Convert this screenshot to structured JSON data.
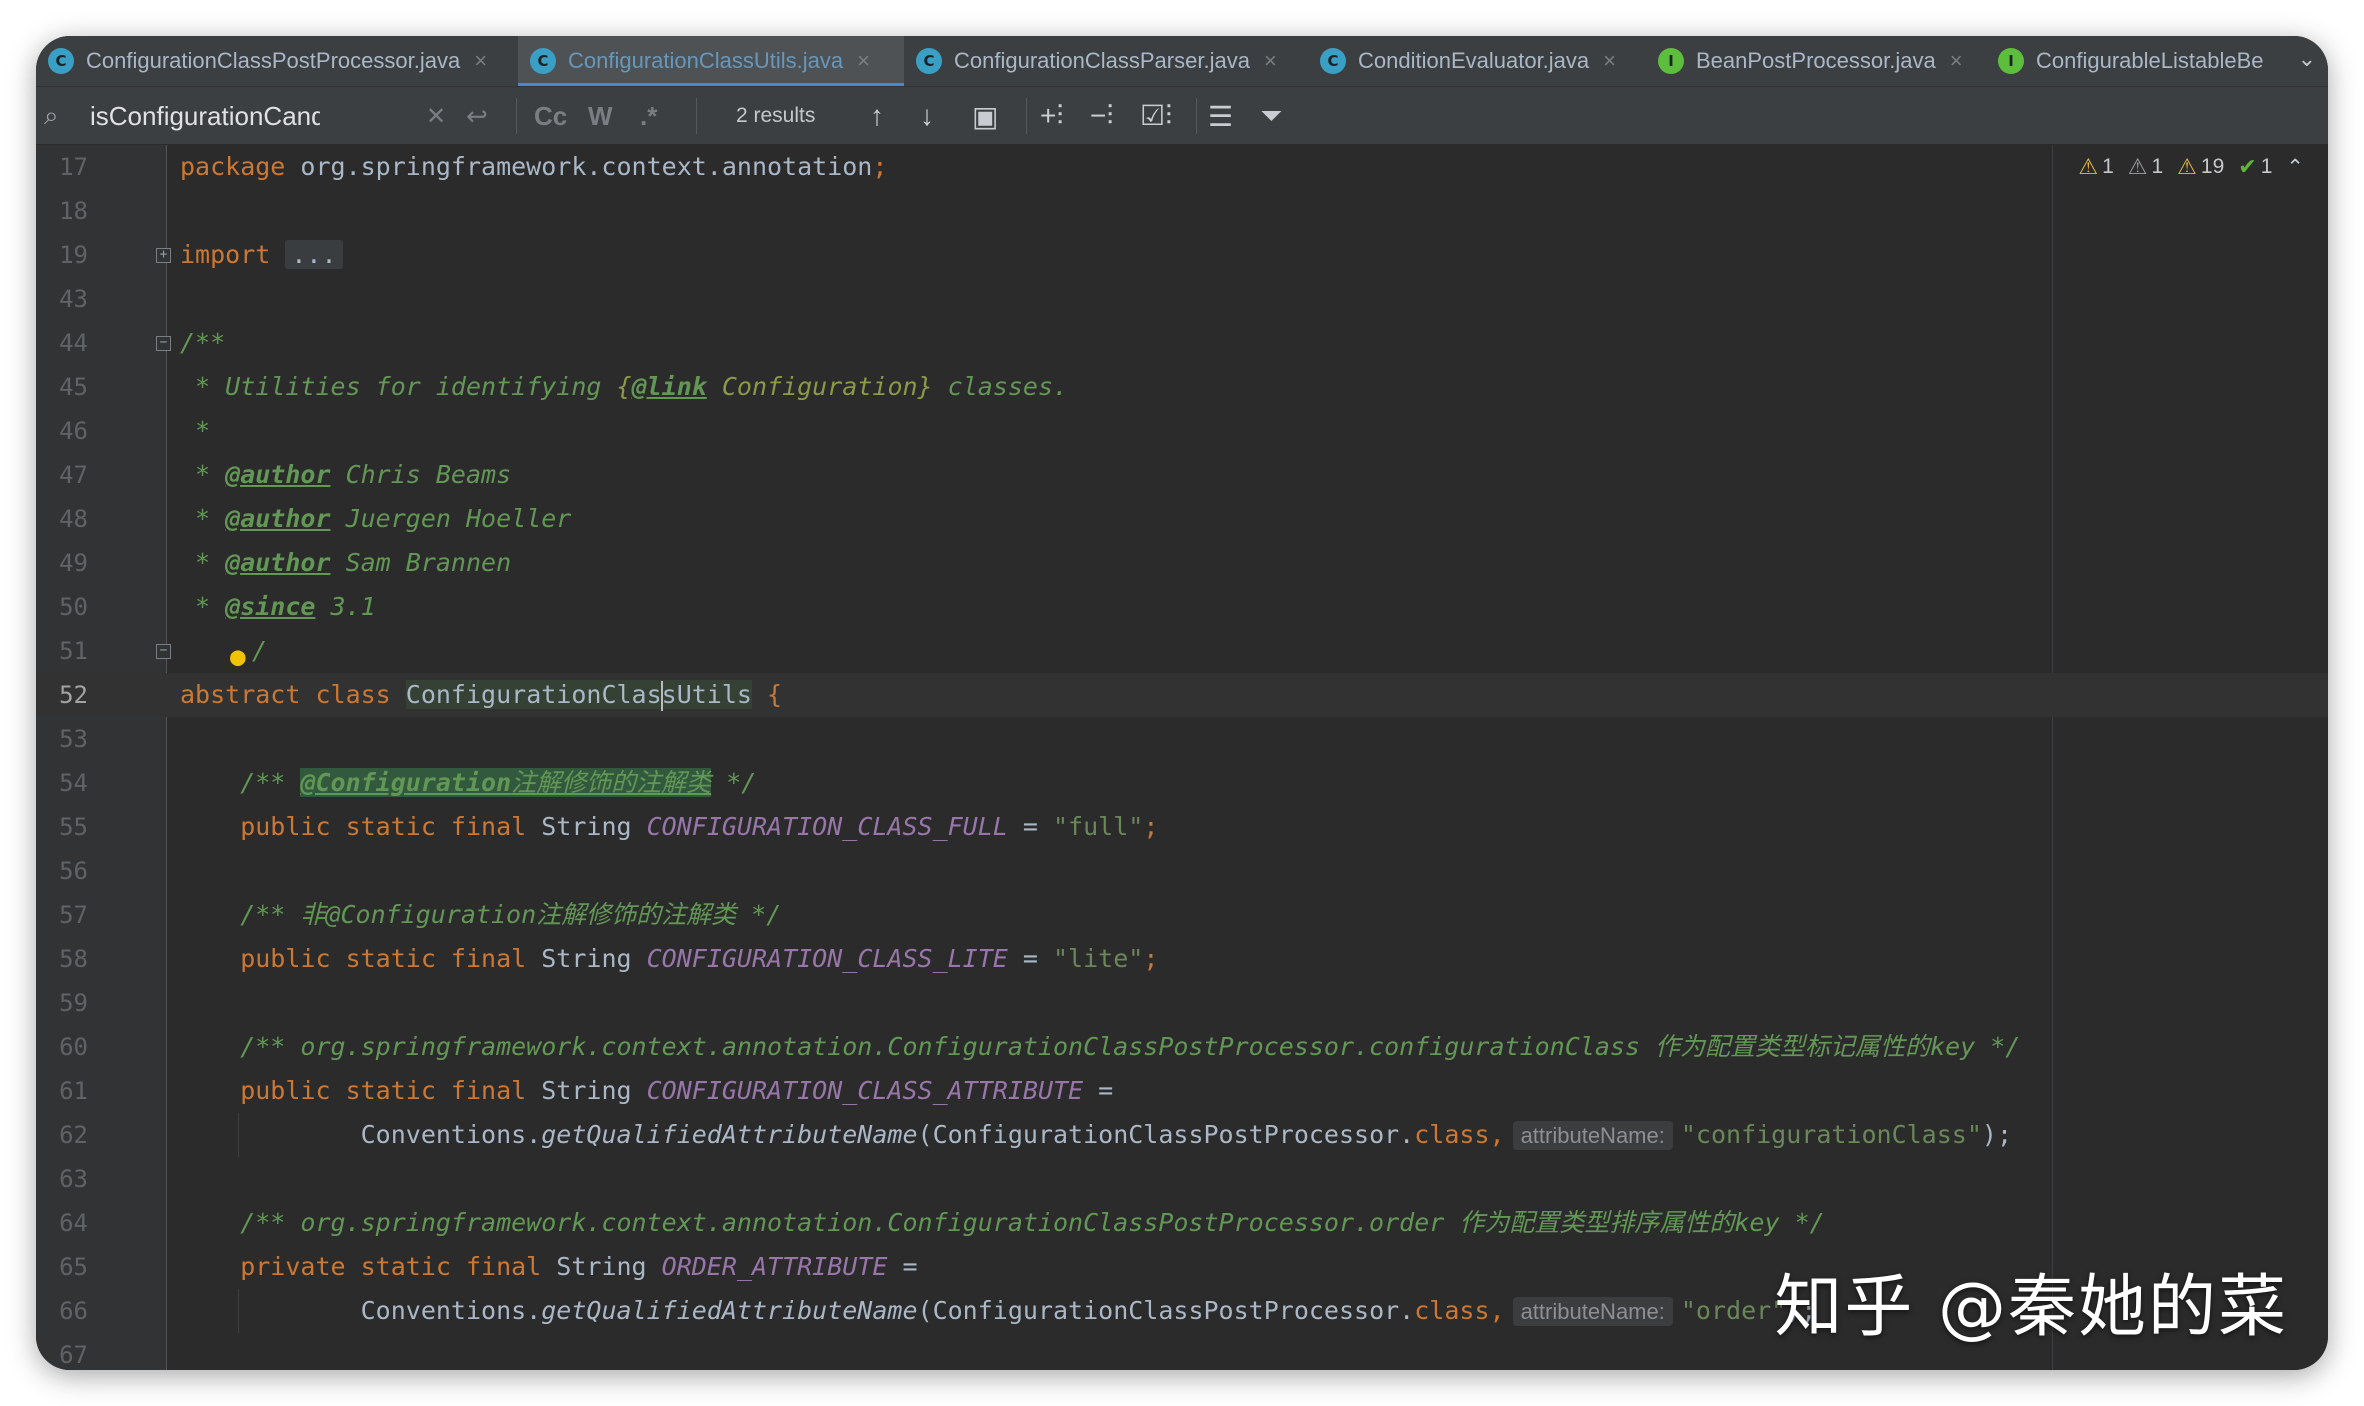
{
  "tabs": [
    {
      "label": "ConfigurationClassPostProcessor.java",
      "icon": "class-icon",
      "icon_letter": "C",
      "active": false
    },
    {
      "label": "ConfigurationClassUtils.java",
      "icon": "class-icon",
      "icon_letter": "C",
      "active": true
    },
    {
      "label": "ConfigurationClassParser.java",
      "icon": "class-icon",
      "icon_letter": "C",
      "active": false
    },
    {
      "label": "ConditionEvaluator.java",
      "icon": "class-icon",
      "icon_letter": "C",
      "active": false
    },
    {
      "label": "BeanPostProcessor.java",
      "icon": "interface-icon",
      "icon_letter": "I",
      "active": false
    },
    {
      "label": "ConfigurableListableBe",
      "icon": "interface-icon",
      "icon_letter": "I",
      "active": false
    }
  ],
  "tab_close_glyph": "×",
  "tab_more_glyph": "⌄",
  "find": {
    "query": "isConfigurationCandidate",
    "results": "2 results",
    "match_case_label": "Cc",
    "words_label": "W",
    "regex_label": ".*"
  },
  "inspections": {
    "warnings_yellow": "1",
    "warnings_gray": "1",
    "weak_warnings": "19",
    "typos": "1"
  },
  "lines": [
    {
      "n": "17"
    },
    {
      "n": "18"
    },
    {
      "n": "19"
    },
    {
      "n": "43"
    },
    {
      "n": "44"
    },
    {
      "n": "45"
    },
    {
      "n": "46"
    },
    {
      "n": "47"
    },
    {
      "n": "48"
    },
    {
      "n": "49"
    },
    {
      "n": "50"
    },
    {
      "n": "51"
    },
    {
      "n": "52"
    },
    {
      "n": "53"
    },
    {
      "n": "54"
    },
    {
      "n": "55"
    },
    {
      "n": "56"
    },
    {
      "n": "57"
    },
    {
      "n": "58"
    },
    {
      "n": "59"
    },
    {
      "n": "60"
    },
    {
      "n": "61"
    },
    {
      "n": "62"
    },
    {
      "n": "63"
    },
    {
      "n": "64"
    },
    {
      "n": "65"
    },
    {
      "n": "66"
    },
    {
      "n": "67"
    }
  ],
  "code": {
    "l17_kw": "package",
    "l17_pkg": " org.springframework.context.annotation",
    "l17_semi": ";",
    "l19_kw": "import",
    "l19_folded": "...",
    "l44_doc": "/**",
    "l45_doc": " * Utilities for identifying ",
    "l45_link_open": "{",
    "l45_link_tag": "@link",
    "l45_link_ref": " Configuration",
    "l45_link_close": "}",
    "l45_doc_end": " classes.",
    "l46_doc": " *",
    "l47_star": " * ",
    "l47_tag": "@author",
    "l47_text": " Chris Beams",
    "l48_star": " * ",
    "l48_tag": "@author",
    "l48_text": " Juergen Hoeller",
    "l49_star": " * ",
    "l49_tag": "@author",
    "l49_text": " Sam Brannen",
    "l50_star": " * ",
    "l50_tag": "@since",
    "l50_text": " 3.1",
    "l51_doc": "/",
    "l52_kw": "abstract class",
    "l52_name_a": "ConfigurationClas",
    "l52_name_b": "sUtils",
    "l52_brace": " {",
    "l54_open": "    /** ",
    "l54_tag": "@Configuration",
    "l54_cn": "注解修饰的注解类",
    "l54_close": " */",
    "l55_kw": "    public static final",
    "l55_type": " String ",
    "l55_const": "CONFIGURATION_CLASS_FULL",
    "l55_eq": " = ",
    "l55_str": "\"full\"",
    "l55_semi": ";",
    "l57_comment": "    /** 非@Configuration注解修饰的注解类 */",
    "l58_kw": "    public static final",
    "l58_type": " String ",
    "l58_const": "CONFIGURATION_CLASS_LITE",
    "l58_eq": " = ",
    "l58_str": "\"lite\"",
    "l58_semi": ";",
    "l60_comment": "    /** org.springframework.context.annotation.ConfigurationClassPostProcessor.configurationClass 作为配置类型标记属性的key */",
    "l61_kw": "    public static final",
    "l61_type": " String ",
    "l61_const": "CONFIGURATION_CLASS_ATTRIBUTE",
    "l61_eq": " =",
    "l62_call_a": "            Conventions.",
    "l62_meth": "getQualifiedAttributeName",
    "l62_arg": "(ConfigurationClassPostProcessor.",
    "l62_class": "class",
    "l62_comma": ",",
    "l62_hint": "attributeName:",
    "l62_str": "\"configurationClass\"",
    "l62_end": ");",
    "l64_comment": "    /** org.springframework.context.annotation.ConfigurationClassPostProcessor.order 作为配置类型排序属性的key */",
    "l65_kw": "    private static final",
    "l65_type": " String ",
    "l65_const": "ORDER_ATTRIBUTE",
    "l65_eq": " =",
    "l66_call_a": "            Conventions.",
    "l66_meth": "getQualifiedAttributeName",
    "l66_arg": "(ConfigurationClassPostProcessor.",
    "l66_class": "class",
    "l66_comma": ",",
    "l66_hint": "attributeName:",
    "l66_str": "\"order\"",
    "l66_end": ");"
  },
  "watermark": "知乎 @秦她的菜"
}
